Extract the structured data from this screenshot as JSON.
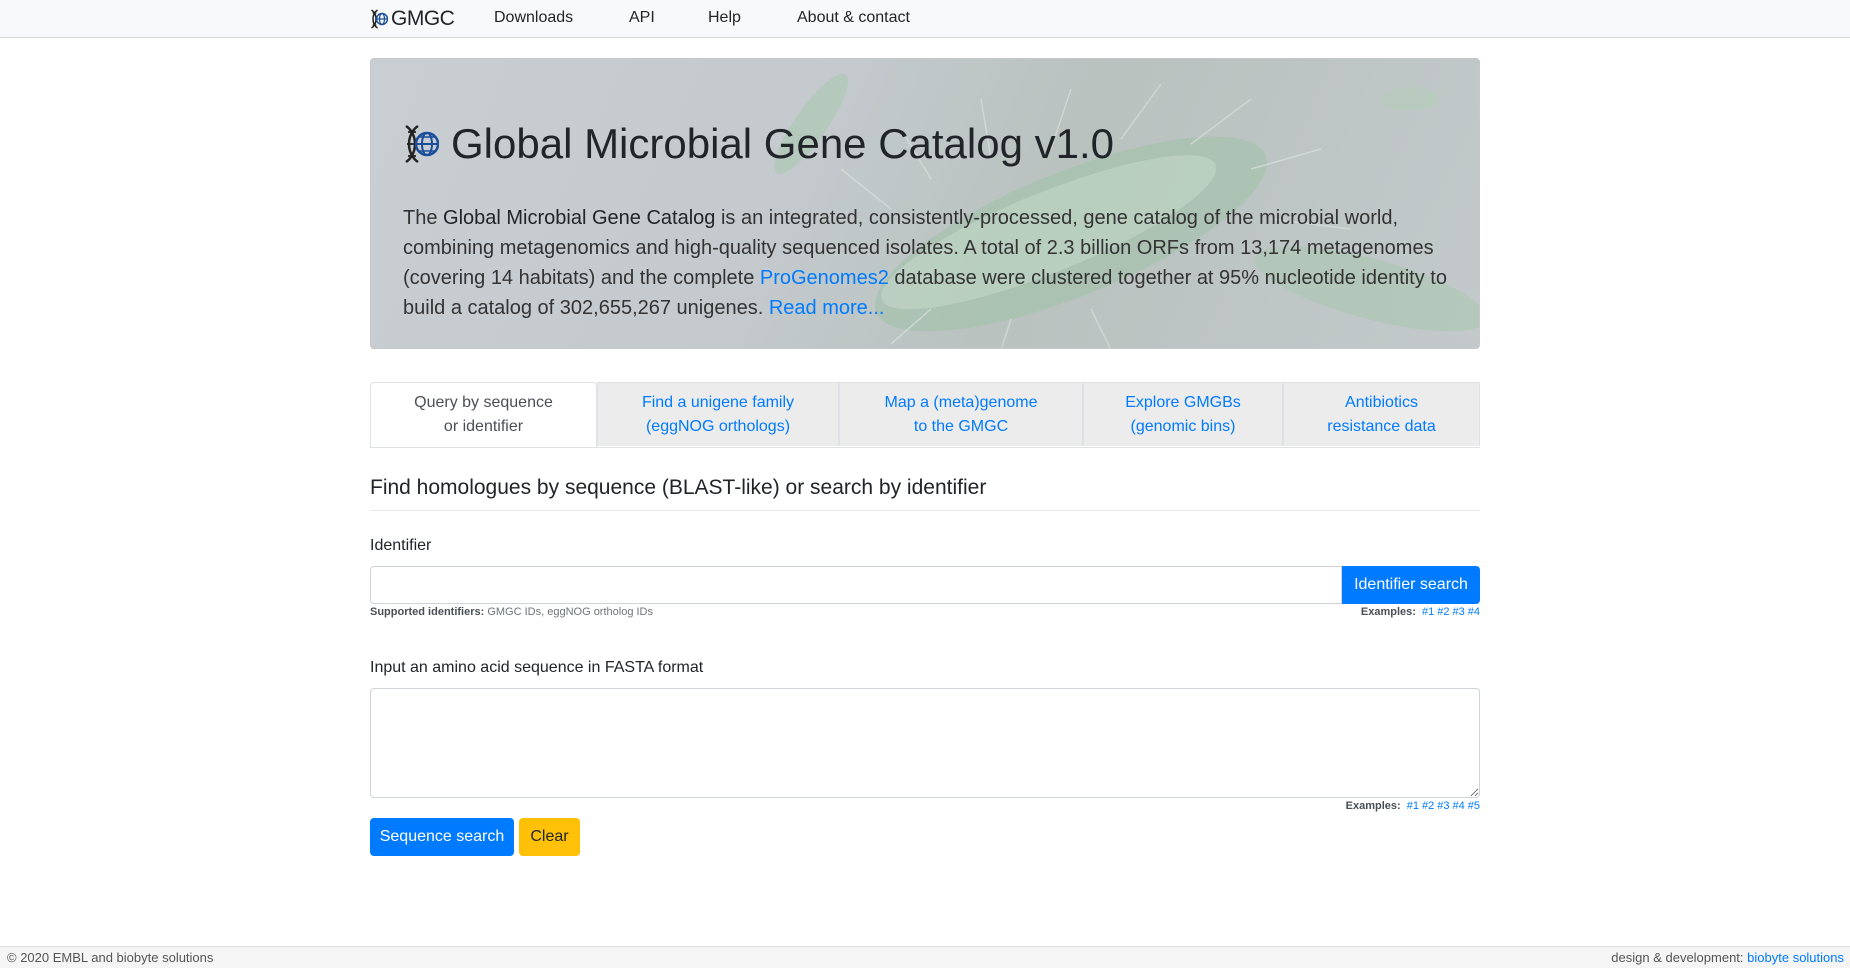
{
  "navbar": {
    "brand": "GMGC",
    "links": [
      "Downloads",
      "API",
      "Help",
      "About & contact"
    ]
  },
  "hero": {
    "title": "Global Microbial Gene Catalog v1.0",
    "lead_part1": "The ",
    "lead_strong": "Global Microbial Gene Catalog",
    "lead_part2": " is an integrated, consistently-processed, gene catalog of the microbial world, combining metagenomics and high-quality sequenced isolates. A total of 2.3 billion ORFs from 13,174 metagenomes (covering 14 habitats) and the complete ",
    "progenomes_link": "ProGenomes2",
    "lead_part3": " database were clustered together at 95% nucleotide identity to build a catalog of 302,655,267 unigenes. ",
    "read_more": "Read more..."
  },
  "tabs": [
    {
      "line1": "Query by sequence",
      "line2": "or identifier",
      "active": true
    },
    {
      "line1": "Find a unigene family",
      "line2": "(eggNOG orthologs)",
      "active": false
    },
    {
      "line1": "Map a (meta)genome",
      "line2": "to the GMGC",
      "active": false
    },
    {
      "line1": "Explore GMGBs",
      "line2": "(genomic bins)",
      "active": false
    },
    {
      "line1": "Antibiotics",
      "line2": "resistance data",
      "active": false
    }
  ],
  "main": {
    "title": "Find homologues by sequence (BLAST-like) or search by identifier",
    "identifier_label": "Identifier",
    "identifier_value": "",
    "identifier_button": "Identifier search",
    "supported_label": "Supported identifiers:",
    "supported_text": " GMGC IDs, eggNOG ortholog IDs",
    "examples_label": "Examples:",
    "id_examples": [
      "#1",
      "#2",
      "#3",
      "#4"
    ],
    "sequence_label": "Input an amino acid sequence in FASTA format",
    "sequence_value": "",
    "seq_examples": [
      "#1",
      "#2",
      "#3",
      "#4",
      "#5"
    ],
    "sequence_button": "Sequence search",
    "clear_button": "Clear"
  },
  "footer": {
    "copyright": "© 2020 EMBL and biobyte solutions",
    "design_label": "design & development: ",
    "design_link": "biobyte solutions"
  },
  "colors": {
    "primary": "#007bff",
    "warning": "#ffc107",
    "icon_blue": "#1a4e9a"
  },
  "icons": [
    "dna-globe-icon"
  ]
}
